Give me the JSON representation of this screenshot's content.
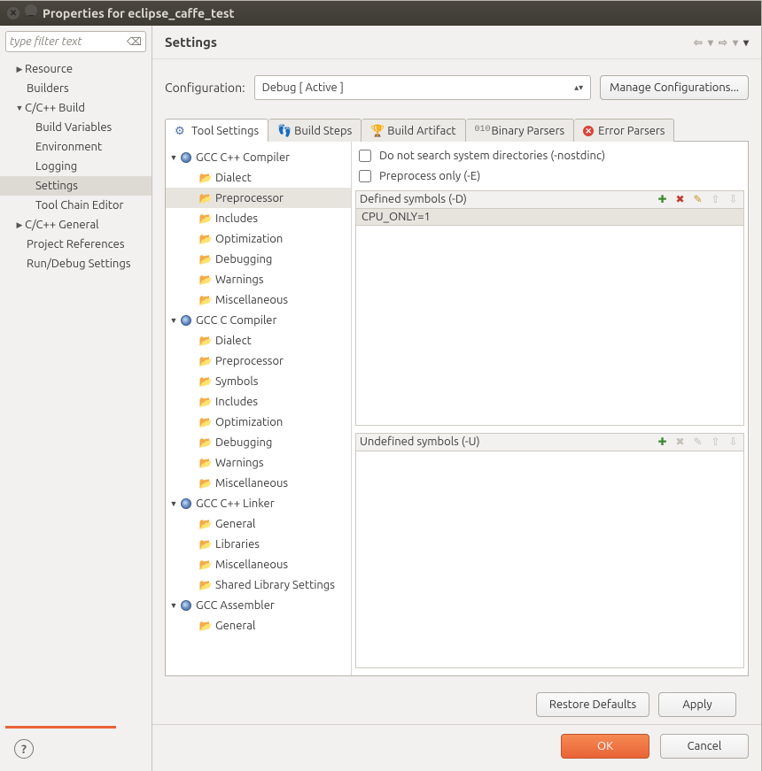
{
  "title": "Properties for eclipse_caffe_test",
  "filter_placeholder": "type filter text",
  "left_nav": [
    {
      "label": "Resource",
      "expand": true
    },
    {
      "label": "Builders"
    },
    {
      "label": "C/C++ Build",
      "expand": true,
      "open": true
    },
    {
      "label": "Build Variables",
      "indent": true
    },
    {
      "label": "Environment",
      "indent": true
    },
    {
      "label": "Logging",
      "indent": true
    },
    {
      "label": "Settings",
      "indent": true,
      "selected": true
    },
    {
      "label": "Tool Chain Editor",
      "indent": true
    },
    {
      "label": "C/C++ General",
      "expand": true
    },
    {
      "label": "Project References"
    },
    {
      "label": "Run/Debug Settings"
    }
  ],
  "heading": "Settings",
  "config_label": "Configuration:",
  "config_value": "Debug  [ Active ]",
  "manage_label": "Manage Configurations...",
  "tabs": [
    {
      "label": "Tool Settings",
      "active": true,
      "icon": "gear"
    },
    {
      "label": "Build Steps",
      "icon": "steps"
    },
    {
      "label": "Build Artifact",
      "icon": "artifact"
    },
    {
      "label": "Binary Parsers",
      "icon": "bin"
    },
    {
      "label": "Error Parsers",
      "icon": "err"
    }
  ],
  "tooltree": [
    {
      "label": "GCC C++ Compiler",
      "type": "group"
    },
    {
      "label": "Dialect",
      "type": "leaf"
    },
    {
      "label": "Preprocessor",
      "type": "leaf",
      "selected": true
    },
    {
      "label": "Includes",
      "type": "leaf"
    },
    {
      "label": "Optimization",
      "type": "leaf"
    },
    {
      "label": "Debugging",
      "type": "leaf"
    },
    {
      "label": "Warnings",
      "type": "leaf"
    },
    {
      "label": "Miscellaneous",
      "type": "leaf"
    },
    {
      "label": "GCC C Compiler",
      "type": "group"
    },
    {
      "label": "Dialect",
      "type": "leaf"
    },
    {
      "label": "Preprocessor",
      "type": "leaf"
    },
    {
      "label": "Symbols",
      "type": "leaf"
    },
    {
      "label": "Includes",
      "type": "leaf"
    },
    {
      "label": "Optimization",
      "type": "leaf"
    },
    {
      "label": "Debugging",
      "type": "leaf"
    },
    {
      "label": "Warnings",
      "type": "leaf"
    },
    {
      "label": "Miscellaneous",
      "type": "leaf"
    },
    {
      "label": "GCC C++ Linker",
      "type": "group"
    },
    {
      "label": "General",
      "type": "leaf"
    },
    {
      "label": "Libraries",
      "type": "leaf"
    },
    {
      "label": "Miscellaneous",
      "type": "leaf"
    },
    {
      "label": "Shared Library Settings",
      "type": "leaf"
    },
    {
      "label": "GCC Assembler",
      "type": "group"
    },
    {
      "label": "General",
      "type": "leaf"
    }
  ],
  "check1": "Do not search system directories (-nostdinc)",
  "check2": "Preprocess only (-E)",
  "defined_label": "Defined symbols (-D)",
  "defined_items": [
    "CPU_ONLY=1"
  ],
  "undefined_label": "Undefined symbols (-U)",
  "undefined_items": [],
  "restore_label": "Restore Defaults",
  "apply_label": "Apply",
  "ok_label": "OK",
  "cancel_label": "Cancel"
}
